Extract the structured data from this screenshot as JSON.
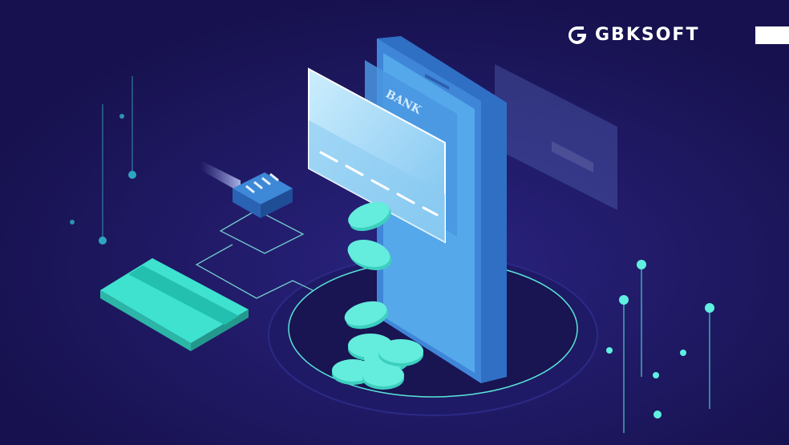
{
  "brand": {
    "name": "GBKSOFT"
  },
  "phone": {
    "card_label": "BANK"
  },
  "colors": {
    "background": "#1b1560",
    "phone_body": "#3f86d8",
    "phone_screen": "#55a8ea",
    "card_front": "#a9dcf6",
    "teal_card": "#3fe2cf",
    "coins": "#4fe0cf",
    "glow": "#5ff0e0"
  },
  "icons": [
    "gbksoft-logo",
    "usb-plug-icon",
    "credit-card-icon",
    "smartphone-icon",
    "coin-stack-icon"
  ]
}
